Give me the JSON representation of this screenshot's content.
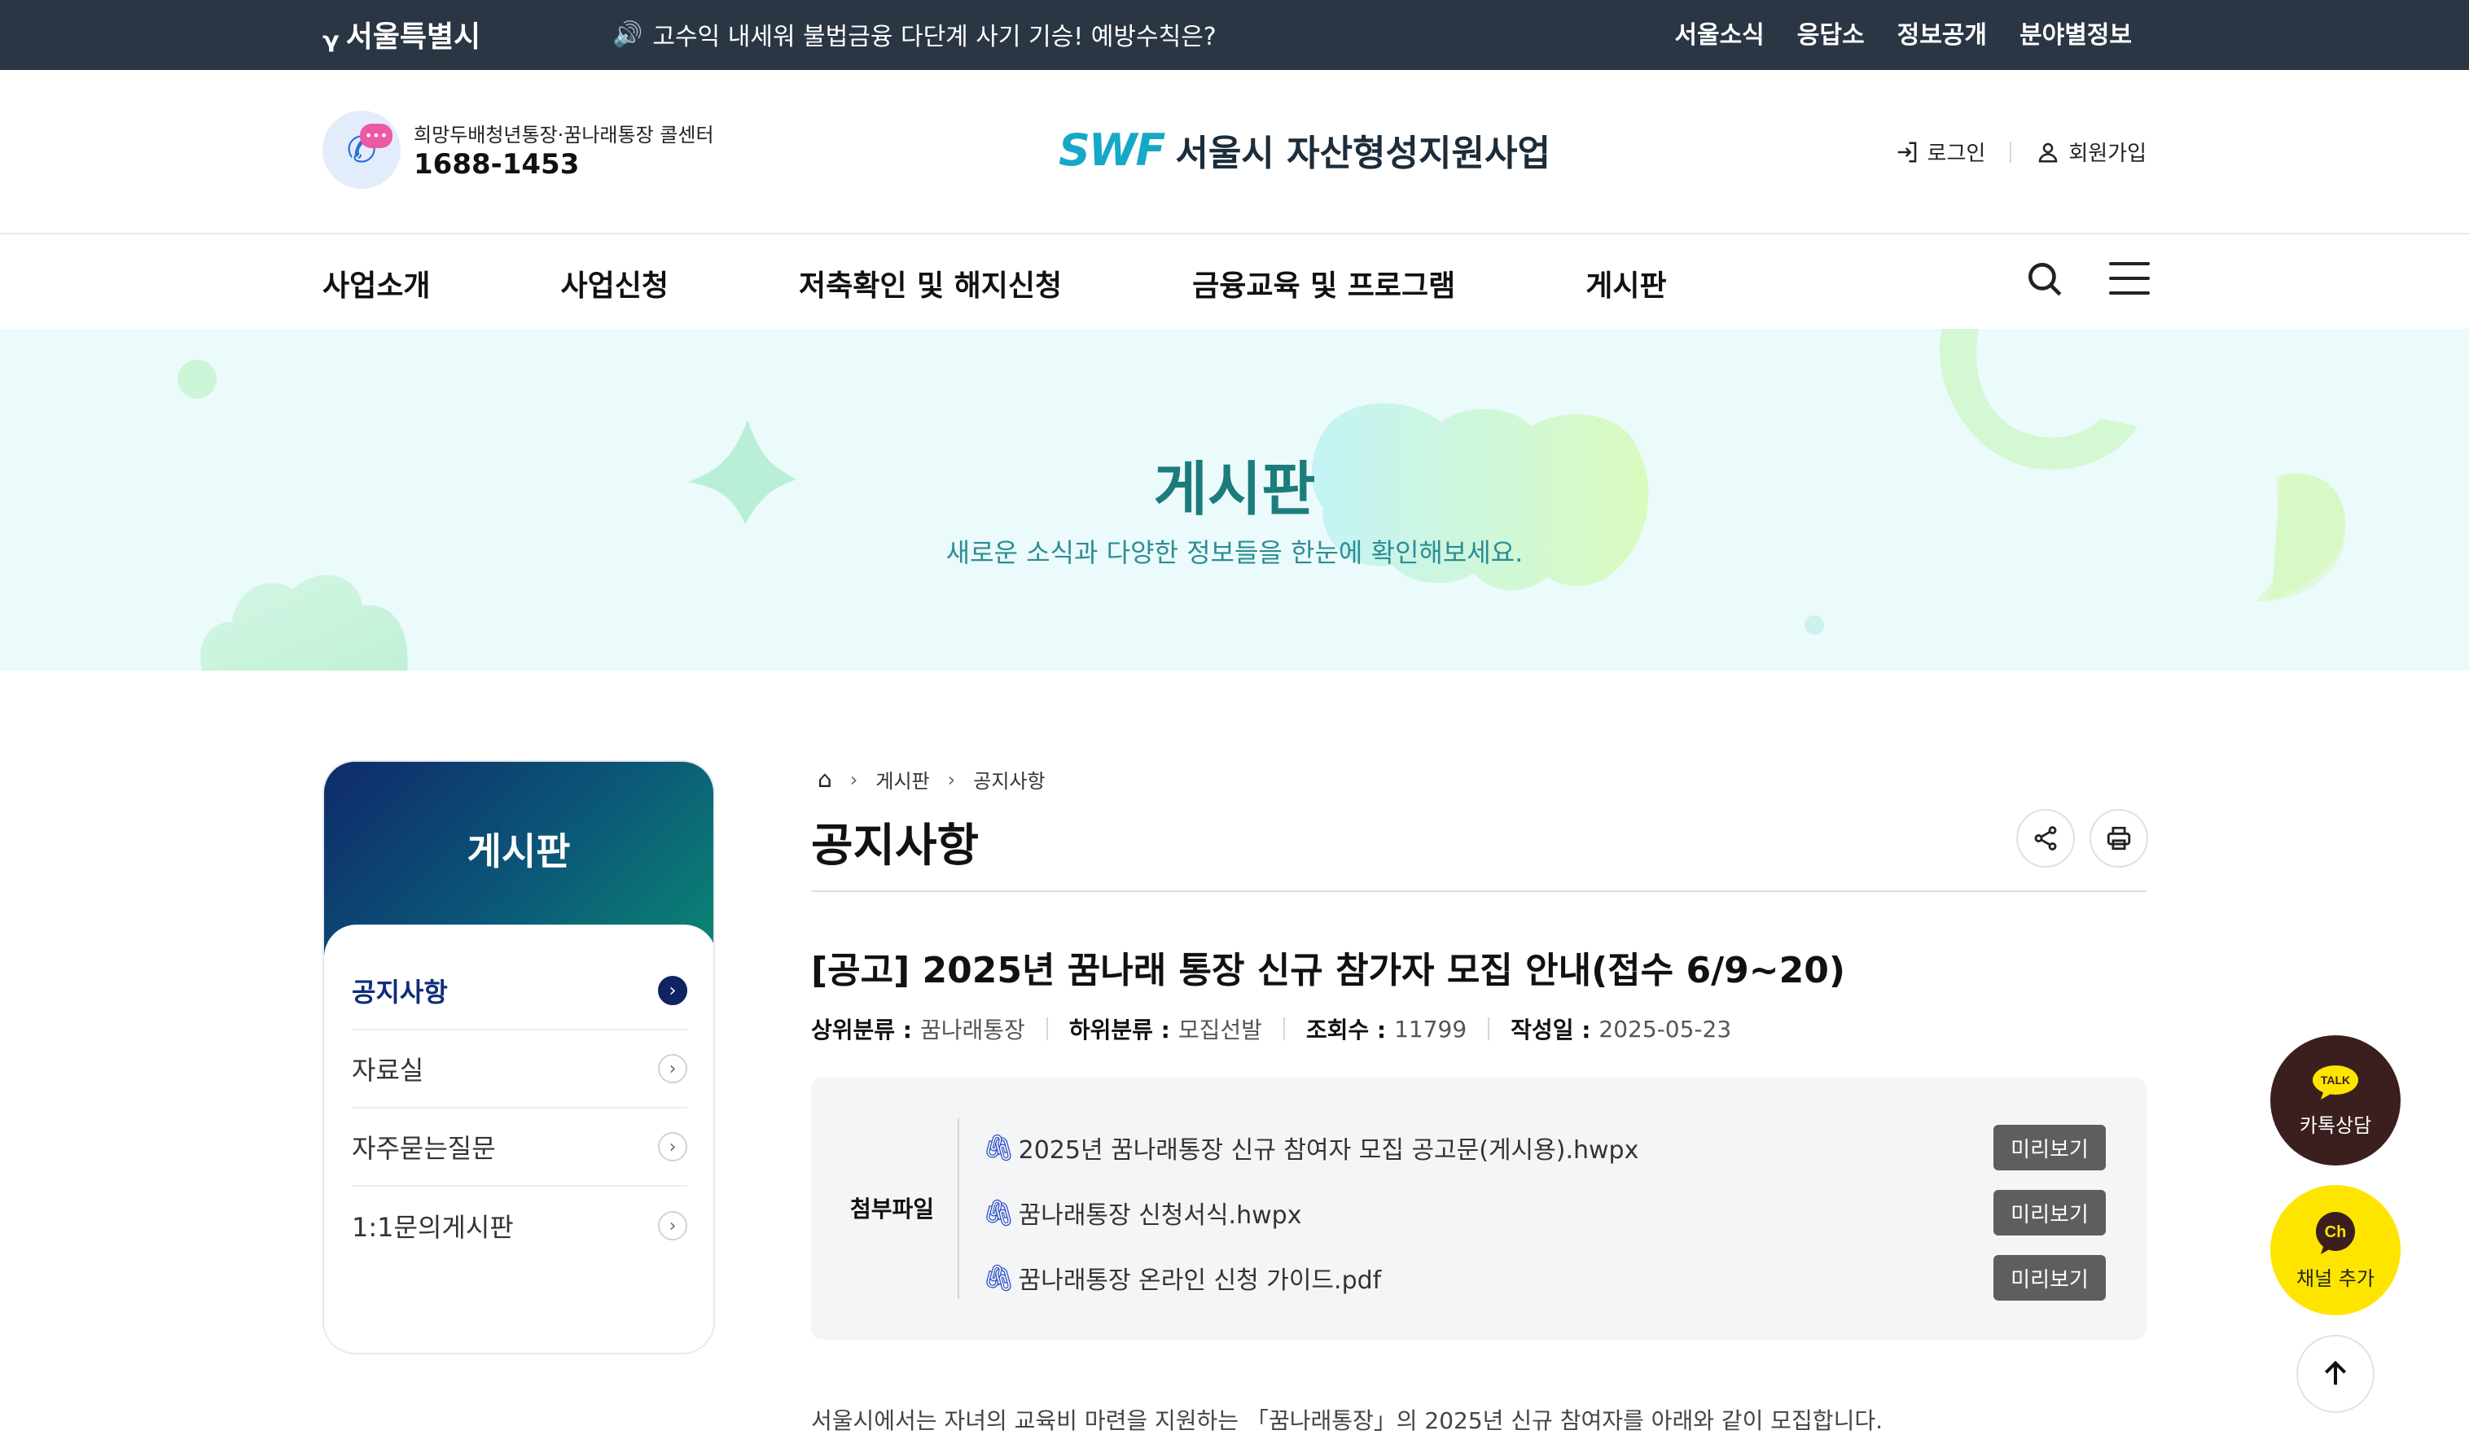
{
  "topbar": {
    "logo_text": "서울특별시",
    "notice": "고수익 내세워 불법금융 다단계 사기 기승! 예방수칙은?",
    "links": [
      "서울소식",
      "응답소",
      "정보공개",
      "분야별정보"
    ]
  },
  "header": {
    "callcenter_label": "희망두배청년통장·꿈나래통장 콜센터",
    "callcenter_phone": "1688-1453",
    "brand_mark": "SWF",
    "brand_name": "서울시 자산형성지원사업",
    "login": "로그인",
    "signup": "회원가입"
  },
  "nav": {
    "items": [
      "사업소개",
      "사업신청",
      "저축확인 및 해지신청",
      "금융교육 및 프로그램",
      "게시판"
    ]
  },
  "hero": {
    "title": "게시판",
    "subtitle": "새로운 소식과 다양한 정보들을 한눈에 확인해보세요."
  },
  "sidebar": {
    "title": "게시판",
    "items": [
      {
        "label": "공지사항",
        "active": true
      },
      {
        "label": "자료실",
        "active": false
      },
      {
        "label": "자주묻는질문",
        "active": false
      },
      {
        "label": "1:1문의게시판",
        "active": false
      }
    ]
  },
  "breadcrumb": [
    "게시판",
    "공지사항"
  ],
  "page_title": "공지사항",
  "post": {
    "title": "[공고] 2025년 꿈나래 통장 신규 참가자 모집 안내(접수 6/9~20)",
    "meta": [
      {
        "key": "상위분류 :",
        "value": "꿈나래통장"
      },
      {
        "key": "하위분류 :",
        "value": "모집선발"
      },
      {
        "key": "조회수 :",
        "value": "11799"
      },
      {
        "key": "작성일 :",
        "value": "2025-05-23"
      }
    ],
    "attachments_label": "첨부파일",
    "attachments": [
      {
        "name": "2025년 꿈나래통장 신규 참여자 모집 공고문(게시용).hwpx",
        "button": "미리보기"
      },
      {
        "name": "꿈나래통장 신청서식.hwpx",
        "button": "미리보기"
      },
      {
        "name": "꿈나래통장 온라인 신청 가이드.pdf",
        "button": "미리보기"
      }
    ],
    "body_first_line": "서울시에서는 자녀의 교육비 마련을 지원하는 「꿈나래통장」의 2025년 신규 참여자를 아래와 같이 모집합니다."
  },
  "floating": {
    "talk_badge": "TALK",
    "talk_label": "카톡상담",
    "ch_badge": "Ch",
    "ch_label": "채널 추가"
  },
  "colors": {
    "topbar_bg": "#2b3644",
    "brand": "#16a8c7",
    "hero_bg": "#ebfbfb",
    "hero_title": "#1c7c7c",
    "sidebar_active": "#0f2460",
    "preview_button": "#5e5e5e",
    "kakao_talk_bg": "#3b1e1e",
    "kakao_ch_bg": "#fee500"
  }
}
